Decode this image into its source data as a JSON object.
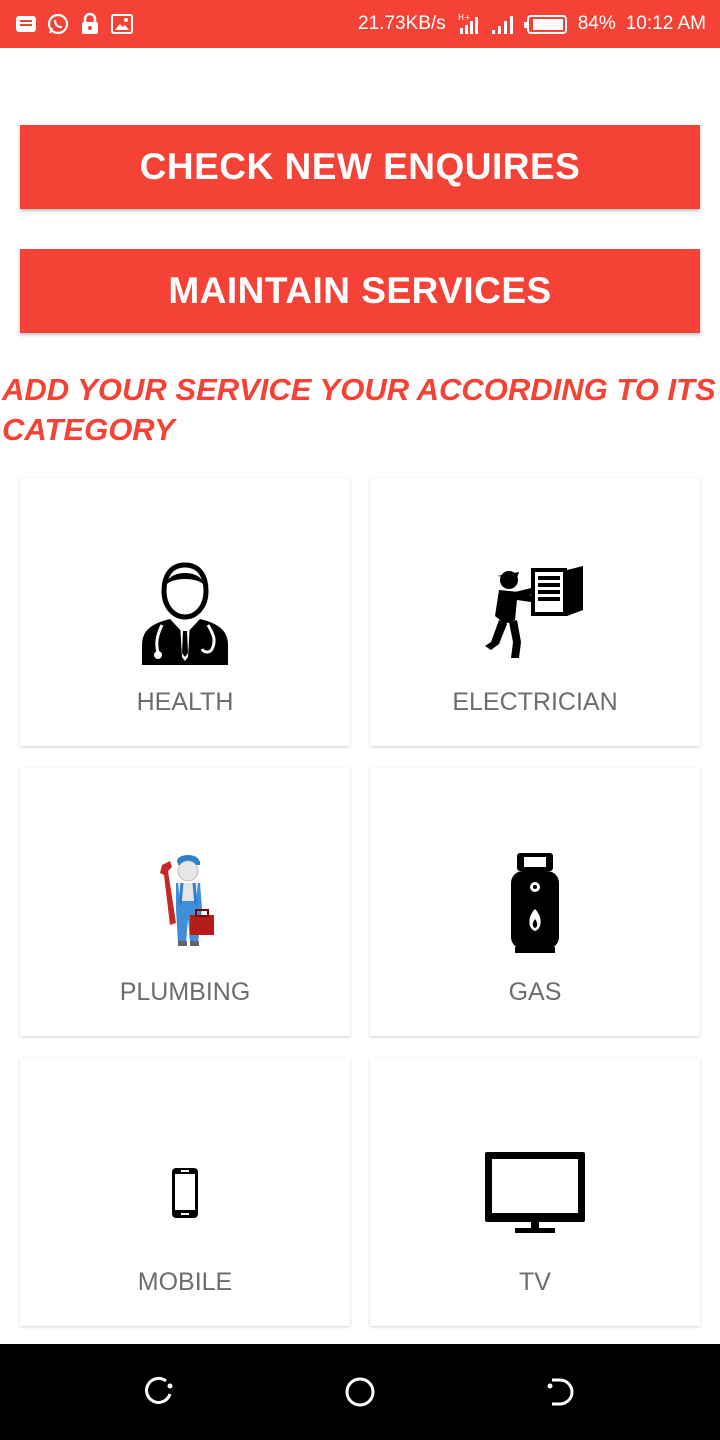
{
  "status_bar": {
    "network_speed": "21.73KB/s",
    "battery": "84%",
    "time": "10:12 AM",
    "icons": [
      "message-icon",
      "whatsapp-icon",
      "lock-icon",
      "screencast-icon",
      "hplus-signal-icon",
      "signal-icon",
      "battery-icon"
    ]
  },
  "buttons": {
    "check_enquires": "CHECK NEW ENQUIRES",
    "maintain_services": "MAINTAIN SERVICES"
  },
  "heading": "ADD YOUR SERVICE YOUR ACCORDING TO ITS CATEGORY",
  "categories": [
    {
      "label": "HEALTH",
      "icon": "doctor-icon"
    },
    {
      "label": "ELECTRICIAN",
      "icon": "electrician-icon"
    },
    {
      "label": "PLUMBING",
      "icon": "plumber-icon"
    },
    {
      "label": "GAS",
      "icon": "gas-cylinder-icon"
    },
    {
      "label": "MOBILE",
      "icon": "mobile-phone-icon"
    },
    {
      "label": "TV",
      "icon": "tv-icon"
    }
  ],
  "nav": {
    "icons": [
      "back-icon",
      "home-icon",
      "recent-apps-icon"
    ]
  },
  "colors": {
    "accent": "#f44336",
    "label_gray": "#6d6d6d",
    "nav_background": "#000000"
  }
}
